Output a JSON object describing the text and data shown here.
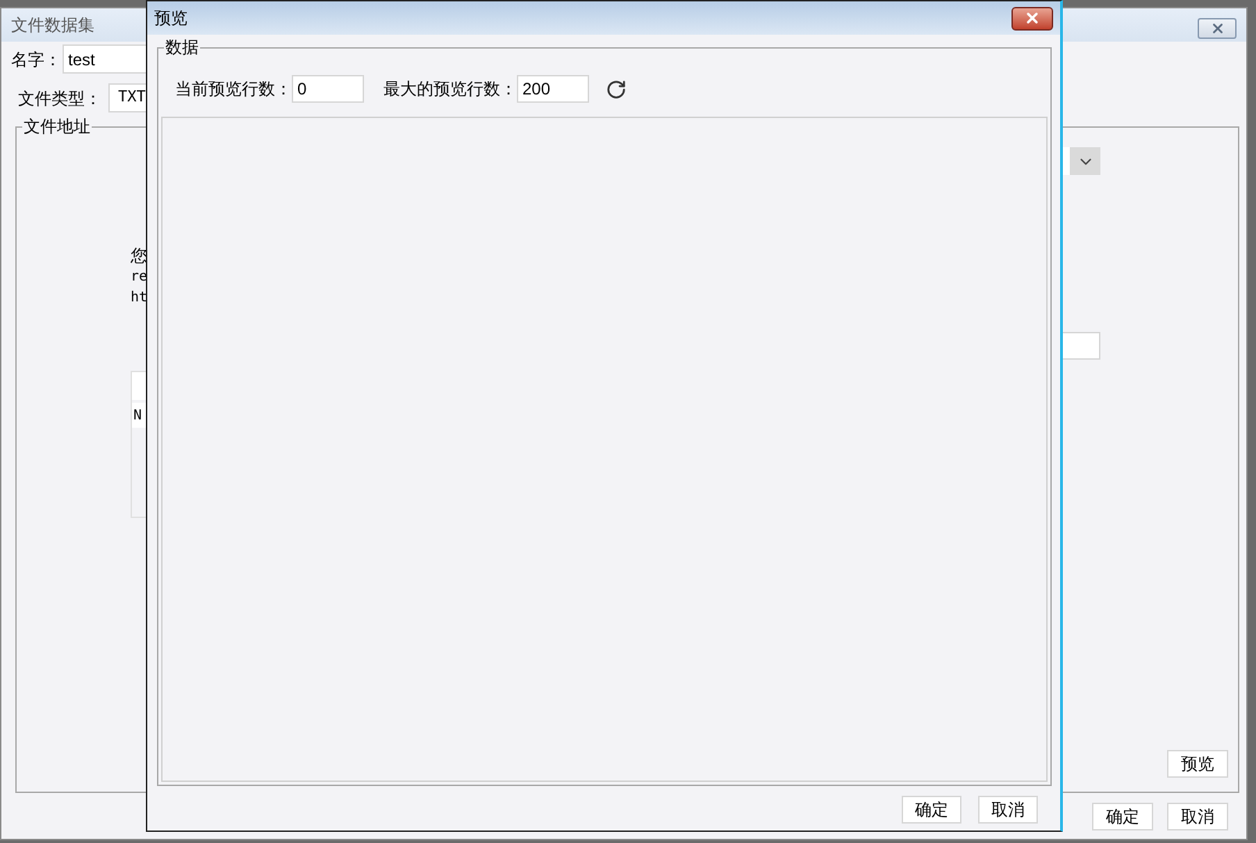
{
  "background_window": {
    "title": "文件数据集",
    "name_label": "名字：",
    "name_value": "test",
    "file_type_label": "文件类型：",
    "file_type_value": "TXT",
    "group_title": "文件地址",
    "partial_lines": [
      "您",
      "re",
      "ht"
    ],
    "table_header": "N",
    "preview_button": "预览",
    "ok_button": "确定",
    "cancel_button": "取消"
  },
  "dialog": {
    "title": "预览",
    "group_title": "数据",
    "current_rows_label": "当前预览行数：",
    "current_rows_value": "0",
    "max_rows_label": "最大的预览行数：",
    "max_rows_value": "200",
    "ok_button": "确定",
    "cancel_button": "取消"
  }
}
